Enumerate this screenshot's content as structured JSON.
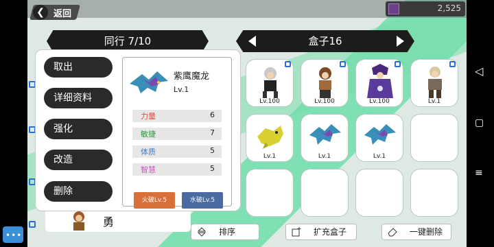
{
  "top": {
    "back_label": "返回",
    "currency_value": "2,525"
  },
  "party_banner": "同行 7/10",
  "box_banner": "盒子16",
  "menu": [
    "取出",
    "详细资料",
    "强化",
    "改造",
    "删除"
  ],
  "item": {
    "name": "紫鹰魔龙",
    "level": "Lv.1",
    "stats": [
      {
        "name": "力量",
        "value": "6",
        "color": "#e0503c"
      },
      {
        "name": "敏捷",
        "value": "7",
        "color": "#2a9a3a"
      },
      {
        "name": "体质",
        "value": "5",
        "color": "#3a7fd6"
      },
      {
        "name": "智慧",
        "value": "5",
        "color": "#d050c8"
      }
    ],
    "fire_break": "火破Lv.5",
    "water_break": "水破Lv.5"
  },
  "slots": [
    {
      "level": "Lv.100",
      "locked": true,
      "kind": "hero-silver"
    },
    {
      "level": "Lv.100",
      "locked": true,
      "kind": "hero-brown"
    },
    {
      "level": "Lv.100",
      "locked": true,
      "kind": "hero-purple"
    },
    {
      "level": "Lv.1",
      "locked": true,
      "kind": "hero-knight"
    },
    {
      "level": "Lv.1",
      "locked": false,
      "kind": "yellow-dragon"
    },
    {
      "level": "Lv.1",
      "locked": false,
      "kind": "blue-dragon"
    },
    {
      "level": "Lv.1",
      "locked": false,
      "kind": "blue-dragon"
    },
    {
      "level": "",
      "locked": false,
      "kind": "empty"
    },
    {
      "level": "",
      "locked": false,
      "kind": "empty"
    },
    {
      "level": "",
      "locked": false,
      "kind": "empty"
    },
    {
      "level": "",
      "locked": false,
      "kind": "empty"
    },
    {
      "level": "",
      "locked": false,
      "kind": "empty"
    }
  ],
  "hero_name": "勇",
  "bottom": {
    "sort": "排序",
    "expand": "扩充盒子",
    "delete_all": "一键删除"
  },
  "colors": {
    "fire": "#d9703a",
    "water": "#4a6aa0"
  }
}
